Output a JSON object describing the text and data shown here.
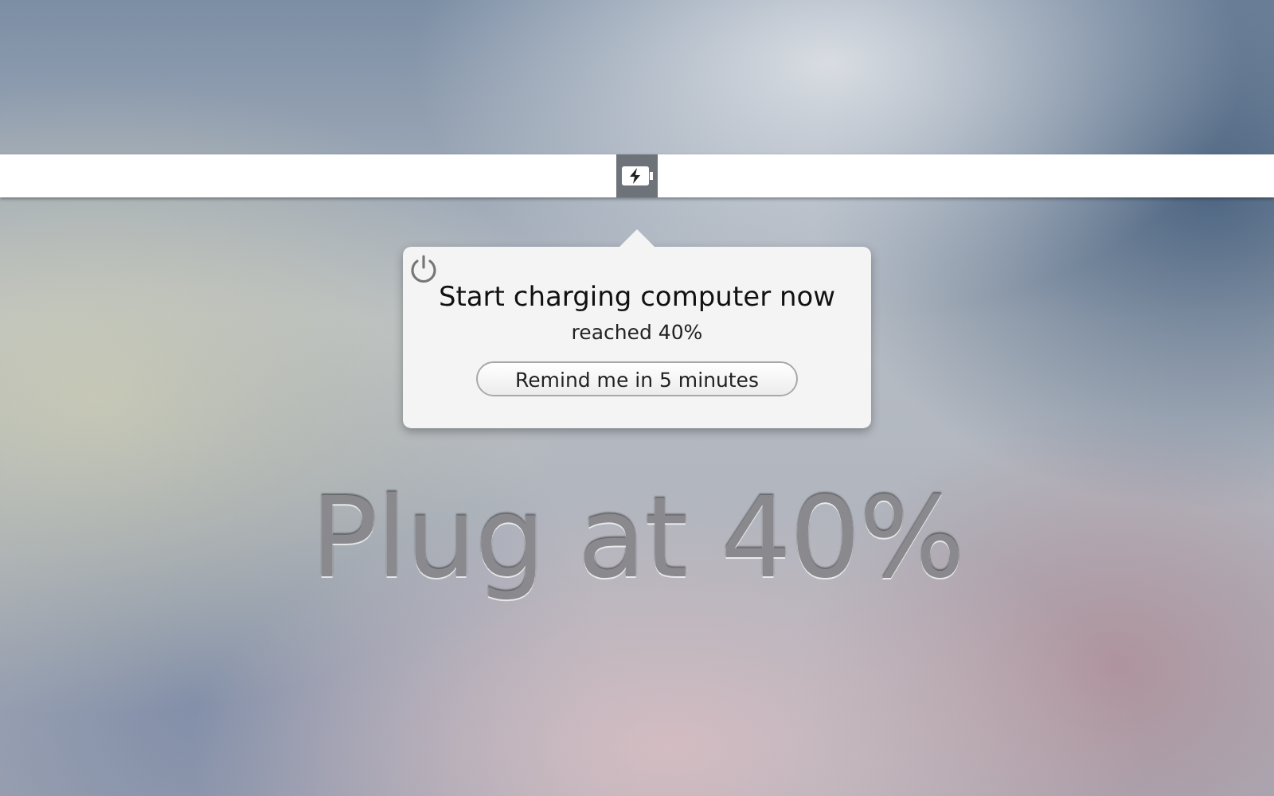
{
  "popover": {
    "title": "Start charging computer now",
    "subtitle": "reached 40%",
    "button": "Remind me in 5 minutes"
  },
  "headline": "Plug at 40%"
}
